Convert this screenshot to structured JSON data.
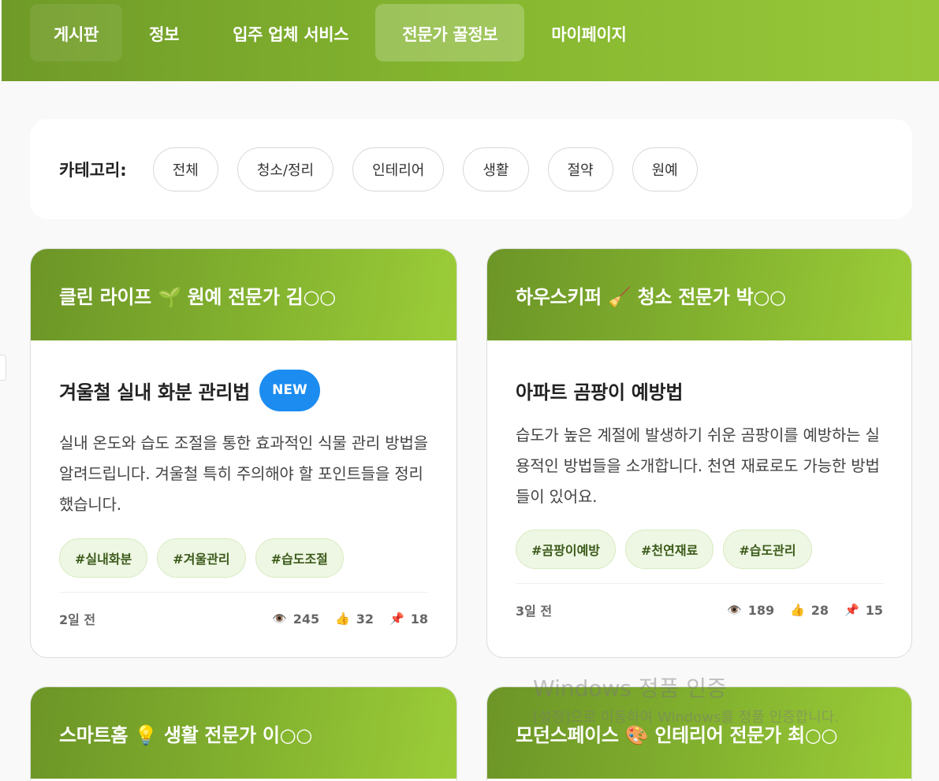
{
  "nav": {
    "items": [
      {
        "label": "게시판"
      },
      {
        "label": "정보"
      },
      {
        "label": "입주 업체 서비스"
      },
      {
        "label": "전문가 꿀정보",
        "active": true
      },
      {
        "label": "마이페이지"
      }
    ]
  },
  "categories": {
    "label": "카테고리:",
    "chips": [
      "전체",
      "청소/정리",
      "인테리어",
      "생활",
      "절약",
      "원예"
    ]
  },
  "posts": [
    {
      "expert": "클린 라이프 🌱 원예 전문가 김○○",
      "title": "겨울철 실내 화분 관리법",
      "badge": "NEW",
      "desc": "실내 온도와 습도 조절을 통한 효과적인 식물 관리 방법을 알려드립니다. 겨울철 특히 주의해야 할 포인트들을 정리했습니다.",
      "tags": [
        "#실내화분",
        "#겨울관리",
        "#습도조절"
      ],
      "date": "2일 전",
      "views": "245",
      "likes": "32",
      "pins": "18"
    },
    {
      "expert": "하우스키퍼 🧹 청소 전문가 박○○",
      "title": "아파트 곰팡이 예방법",
      "desc": "습도가 높은 계절에 발생하기 쉬운 곰팡이를 예방하는 실용적인 방법들을 소개합니다. 천연 재료로도 가능한 방법들이 있어요.",
      "tags": [
        "#곰팡이예방",
        "#천연재료",
        "#습도관리"
      ],
      "date": "3일 전",
      "views": "189",
      "likes": "28",
      "pins": "15"
    },
    {
      "expert": "스마트홈 💡 생활 전문가 이○○"
    },
    {
      "expert": "모던스페이스 🎨 인테리어 전문가 최○○"
    }
  ],
  "icons": {
    "views": "eye-icon",
    "likes": "thumbs-up-icon",
    "pins": "pushpin-icon"
  },
  "watermark": {
    "line1": "Windows 정품 인증",
    "line2": "[설정]으로 이동하여 Windows를 정품 인증합니다."
  },
  "colors": {
    "header_green": "#84b32f",
    "badge_blue": "#1c8cf0",
    "tag_bg": "#eef7e3"
  }
}
